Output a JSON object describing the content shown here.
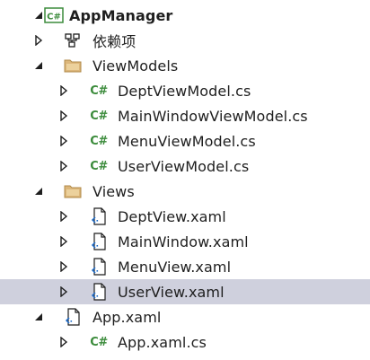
{
  "tree": {
    "project": {
      "label": "AppManager",
      "icon": "csharp-project-icon"
    },
    "dependencies": {
      "label": "依赖项",
      "icon": "dependencies-icon"
    },
    "viewmodels_folder": {
      "label": "ViewModels",
      "files": [
        "DeptViewModel.cs",
        "MainWindowViewModel.cs",
        "MenuViewModel.cs",
        "UserViewModel.cs"
      ]
    },
    "views_folder": {
      "label": "Views",
      "files": [
        "DeptView.xaml",
        "MainWindow.xaml",
        "MenuView.xaml",
        "UserView.xaml"
      ]
    },
    "app_xaml": {
      "label": "App.xaml",
      "child": "App.xaml.cs"
    },
    "selected_item": "UserView.xaml",
    "cs_icon_text": "C#"
  },
  "colors": {
    "selection": "#cfd0dd",
    "csharp_green": "#3b8b3b",
    "folder": "#dcb67a",
    "arrow": "#1e1e1e"
  }
}
